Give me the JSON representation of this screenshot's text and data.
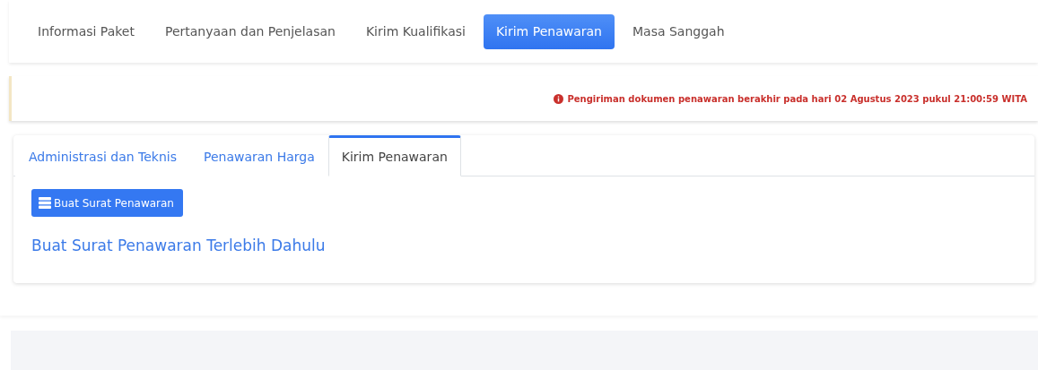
{
  "main_tabs": [
    {
      "label": "Informasi Paket",
      "selected": false
    },
    {
      "label": "Pertanyaan dan Penjelasan",
      "selected": false
    },
    {
      "label": "Kirim Kualifikasi",
      "selected": false
    },
    {
      "label": "Kirim Penawaran",
      "selected": true
    },
    {
      "label": "Masa Sanggah",
      "selected": false
    }
  ],
  "alert": {
    "message": "Pengiriman dokumen penawaran berakhir pada hari 02 Agustus 2023 pukul 21:00:59 WITA"
  },
  "sub_tabs": [
    {
      "label": "Administrasi dan Teknis",
      "selected": false
    },
    {
      "label": "Penawaran Harga",
      "selected": false
    },
    {
      "label": "Kirim Penawaran",
      "selected": true
    }
  ],
  "action_button": {
    "label": "Buat Surat Penawaran"
  },
  "notice": "Buat Surat Penawaran Terlebih Dahulu"
}
